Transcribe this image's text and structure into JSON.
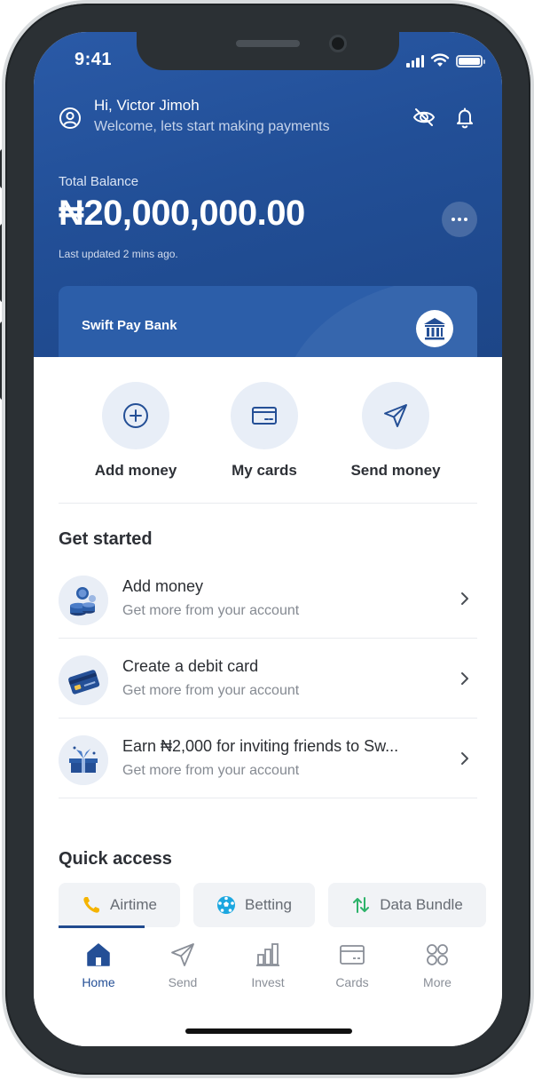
{
  "status_bar": {
    "time": "9:41"
  },
  "header": {
    "greeting": "Hi, Victor Jimoh",
    "welcome": "Welcome, lets start making payments",
    "icons": [
      "user-circle-icon",
      "eye-off-icon",
      "bell-icon"
    ]
  },
  "balance": {
    "label": "Total Balance",
    "amount": "₦20,000,000.00",
    "updated": "Last updated 2 mins ago."
  },
  "bank_card": {
    "name": "Swift Pay Bank",
    "icon": "bank-building-icon"
  },
  "quick_actions": [
    {
      "label": "Add money",
      "icon": "plus-circle-icon"
    },
    {
      "label": "My cards",
      "icon": "card-icon"
    },
    {
      "label": "Send money",
      "icon": "send-icon"
    }
  ],
  "get_started": {
    "title": "Get started",
    "items": [
      {
        "title": "Add money",
        "subtitle": "Get more from your account",
        "icon": "coins-illustration"
      },
      {
        "title": "Create a debit card",
        "subtitle": "Get more from your account",
        "icon": "debit-card-illustration"
      },
      {
        "title": "Earn ₦2,000 for inviting friends to Sw...",
        "subtitle": "Get more from your account",
        "icon": "gift-illustration"
      }
    ]
  },
  "quick_access": {
    "title": "Quick access",
    "chips": [
      {
        "label": "Airtime",
        "icon": "phone-icon"
      },
      {
        "label": "Betting",
        "icon": "soccer-ball-icon"
      },
      {
        "label": "Data Bundle",
        "icon": "up-down-arrows-icon"
      }
    ]
  },
  "tabbar": {
    "items": [
      {
        "label": "Home",
        "icon": "home-icon",
        "active": true
      },
      {
        "label": "Send",
        "icon": "send-icon"
      },
      {
        "label": "Invest",
        "icon": "bar-chart-icon"
      },
      {
        "label": "Cards",
        "icon": "card-icon"
      },
      {
        "label": "More",
        "icon": "grid-circles-icon"
      }
    ]
  },
  "colors": {
    "brand_blue": "#224f97",
    "accent_blue": "#244f96",
    "airtime_icon": "#f5b400",
    "betting_icon": "#1ba7e0",
    "data_icon": "#2db36a"
  }
}
